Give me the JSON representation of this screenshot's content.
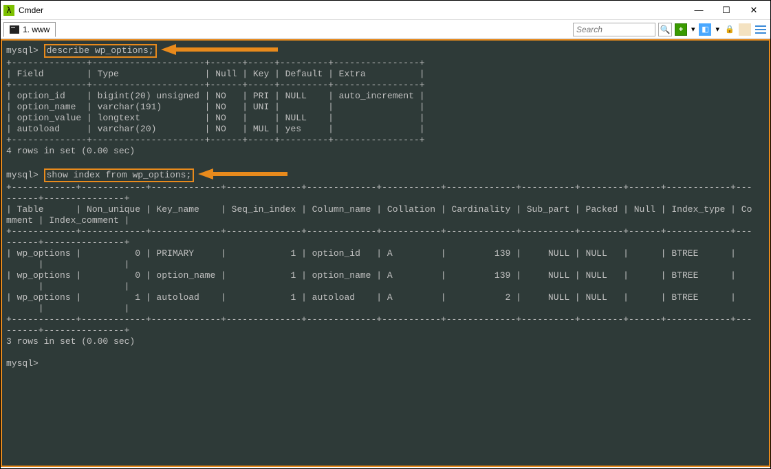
{
  "window": {
    "title": "Cmder",
    "tab_label": "1. www",
    "search_placeholder": "Search",
    "minimize": "—",
    "maximize": "☐",
    "close": "✕"
  },
  "colors": {
    "highlight": "#e88a1c",
    "term_bg": "#2e3a38"
  },
  "term": {
    "prompt": "mysql>",
    "cmd1": "describe wp_options;",
    "desc_header_sep": "+--------------+---------------------+------+-----+---------+----------------+",
    "desc_header": "| Field        | Type                | Null | Key | Default | Extra          |",
    "desc_row1": "| option_id    | bigint(20) unsigned | NO   | PRI | NULL    | auto_increment |",
    "desc_row2": "| option_name  | varchar(191)        | NO   | UNI |         |                |",
    "desc_row3": "| option_value | longtext            | NO   |     | NULL    |                |",
    "desc_row4": "| autoload     | varchar(20)         | NO   | MUL | yes     |                |",
    "desc_footer": "4 rows in set (0.00 sec)",
    "cmd2": "show index from wp_options;",
    "idx_sep": "+------------+------------+-------------+--------------+-------------+-----------+-------------+----------+--------+------+------------+---",
    "idx_sep_c": "------+---------------+",
    "idx_header": "| Table      | Non_unique | Key_name    | Seq_in_index | Column_name | Collation | Cardinality | Sub_part | Packed | Null | Index_type | Co",
    "idx_header_c": "mment | Index_comment |",
    "idx_row1": "| wp_options |          0 | PRIMARY     |            1 | option_id   | A         |         139 |     NULL | NULL   |      | BTREE      |   ",
    "idx_row_c": "      |               |",
    "idx_row2": "| wp_options |          0 | option_name |            1 | option_name | A         |         139 |     NULL | NULL   |      | BTREE      |   ",
    "idx_row3": "| wp_options |          1 | autoload    |            1 | autoload    | A         |           2 |     NULL | NULL   |      | BTREE      |   ",
    "idx_footer": "3 rows in set (0.00 sec)"
  }
}
